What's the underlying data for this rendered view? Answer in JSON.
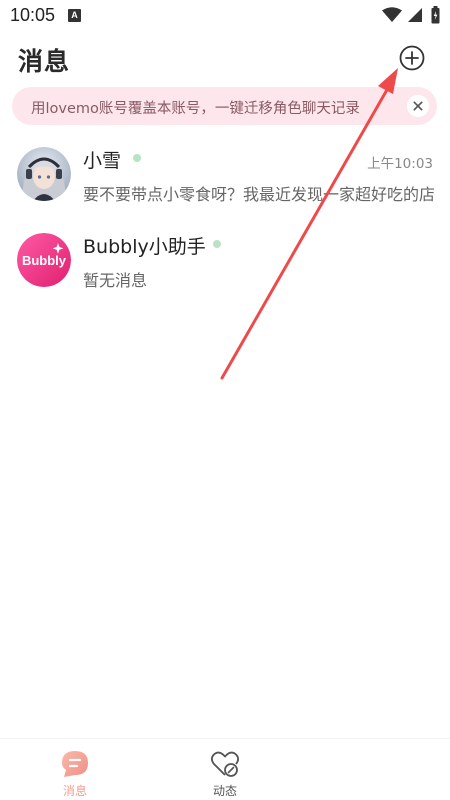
{
  "status_bar": {
    "time": "10:05",
    "app_icon_letter": "A",
    "icons": [
      "wifi-icon",
      "signal-icon",
      "battery-icon"
    ]
  },
  "header": {
    "title": "消息",
    "add_icon": "plus-circle-icon"
  },
  "banner": {
    "text": "用lovemo账号覆盖本账号，一键迁移角色聊天记录",
    "close_icon": "close-icon",
    "background": "#fde7ec"
  },
  "conversations": [
    {
      "name": "小雪",
      "online": true,
      "time": "上午10:03",
      "preview": "要不要带点小零食呀？我最近发现一家超好吃的店"
    },
    {
      "name": "Bubbly小助手",
      "online": true,
      "time": "",
      "preview": "暂无消息",
      "avatar_text": "Bubbly"
    }
  ],
  "bottom_nav": {
    "items": [
      {
        "label": "消息",
        "icon": "message-icon",
        "active": true
      },
      {
        "label": "动态",
        "icon": "moments-icon",
        "active": false
      }
    ]
  },
  "colors": {
    "accent": "#f1a090",
    "online": "#b8e3c4",
    "annotation_arrow": "#ef4a4a"
  }
}
